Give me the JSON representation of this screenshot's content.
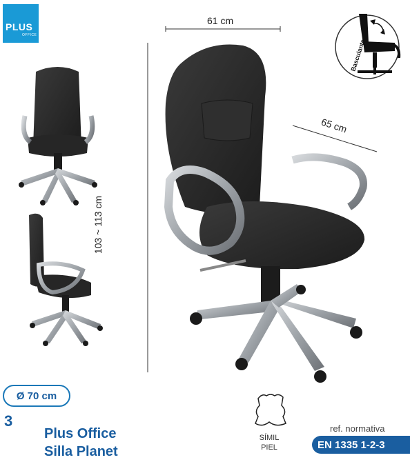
{
  "logo": {
    "brand": "PLUS",
    "sub": "OFFICE"
  },
  "dimensions": {
    "width": "61 cm",
    "depth": "65 cm",
    "height": "103 ~ 113 cm"
  },
  "base_diameter": "Ø 70 cm",
  "feature_badge": {
    "label": "Basculante",
    "icon": "reclining-chair-icon"
  },
  "product": {
    "number": "3",
    "title_line1": "Plus Office",
    "title_line2": "Silla Planet"
  },
  "material": {
    "icon": "leather-hide-icon",
    "line1": "SÍMIL",
    "line2": "PIEL"
  },
  "standard": {
    "ref_label": "ref. normativa",
    "code": "EN 1335 1-2-3"
  },
  "colors": {
    "brand_blue": "#1a5ea0",
    "logo_blue": "#1a9ad6",
    "chair_black": "#2a2a2a",
    "base_silver": "#9ea3a8"
  }
}
